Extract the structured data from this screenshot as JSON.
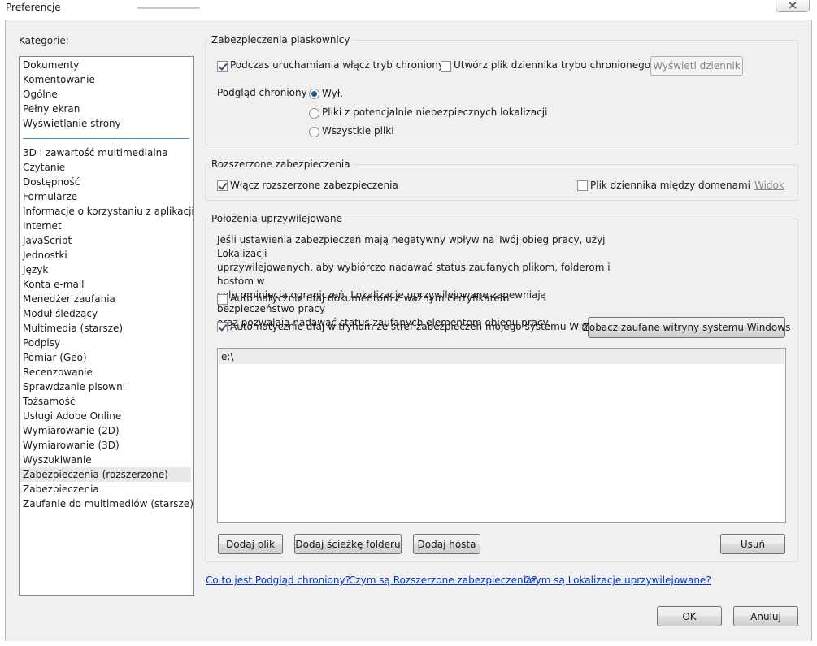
{
  "window": {
    "title": "Preferencje"
  },
  "categories": {
    "label": "Kategorie:",
    "top_items": [
      "Dokumenty",
      "Komentowanie",
      "Ogólne",
      "Pełny ekran",
      "Wyświetlanie strony"
    ],
    "items": [
      "3D i zawartość multimedialna",
      "Czytanie",
      "Dostępność",
      "Formularze",
      "Informacje o korzystaniu z aplikacji",
      "Internet",
      "JavaScript",
      "Jednostki",
      "Język",
      "Konta e-mail",
      "Menedżer zaufania",
      "Moduł śledzący",
      "Multimedia (starsze)",
      "Podpisy",
      "Pomiar (Geo)",
      "Recenzowanie",
      "Sprawdzanie pisowni",
      "Tożsamość",
      "Usługi Adobe Online",
      "Wymiarowanie (2D)",
      "Wymiarowanie (3D)",
      "Wyszukiwanie",
      "Zabezpieczenia (rozszerzone)",
      "Zabezpieczenia",
      "Zaufanie do multimediów (starsze)"
    ],
    "selected": "Zabezpieczenia (rozszerzone)"
  },
  "sandbox": {
    "title": "Zabezpieczenia piaskownicy",
    "protected_mode_label": "Podczas uruchamiania włącz tryb chroniony",
    "protected_mode_checked": true,
    "log_file_label": "Utwórz plik dziennika trybu chronionego",
    "log_file_checked": false,
    "view_log_button": "Wyświetl dziennik",
    "protected_view_label": "Podgląd chroniony",
    "protected_view_options": [
      "Wył.",
      "Pliki z potencjalnie niebezpiecznych lokalizacji",
      "Wszystkie pliki"
    ],
    "protected_view_selected": "Wył."
  },
  "enhanced": {
    "title": "Rozszerzone zabezpieczenia",
    "enable_label": "Włącz rozszerzone zabezpieczenia",
    "enable_checked": true,
    "cross_domain_label": "Plik dziennika między domenami",
    "cross_domain_checked": false,
    "view_link": "Widok"
  },
  "privileged": {
    "title": "Położenia uprzywilejowane",
    "description_lines": [
      "Jeśli ustawienia zabezpieczeń mają negatywny wpływ na Twój obieg pracy, użyj Lokalizacji",
      "uprzywilejowanych, aby wybiórczo nadawać status zaufanych plikom, folderom i hostom w",
      "celu ominięcia ograniczeń. Lokalizacje uprzywilejowane zapewniają bezpieczeństwo pracy",
      "oraz pozwalają nadawać status zaufanych elementom obiegu pracy."
    ],
    "trust_certified_label": "Automatycznie ufaj dokumentom z ważnym certyfikatem",
    "trust_certified_checked": false,
    "trust_windows_label": "Automatycznie ufaj witrynom ze stref zabezpieczeń mojego systemu Windows",
    "trust_windows_checked": true,
    "see_trusted_button": "Zobacz zaufane witryny systemu Windows",
    "paths": [
      "e:\\"
    ],
    "add_file_button": "Dodaj plik",
    "add_folder_button": "Dodaj ścieżkę folderu",
    "add_host_button": "Dodaj hosta",
    "remove_button": "Usuń"
  },
  "help_links": [
    "Co to jest Podgląd chroniony?",
    "Czym są Rozszerzone zabezpieczenia?",
    "Czym są Lokalizacje uprzywilejowane?"
  ],
  "footer": {
    "ok_button": "OK",
    "cancel_button": "Anuluj"
  },
  "colors": {
    "link": "#0033cc",
    "selection": "#e8e8e8",
    "separator": "#3e8fd1",
    "dialog_bg": "#f0f0f0"
  }
}
